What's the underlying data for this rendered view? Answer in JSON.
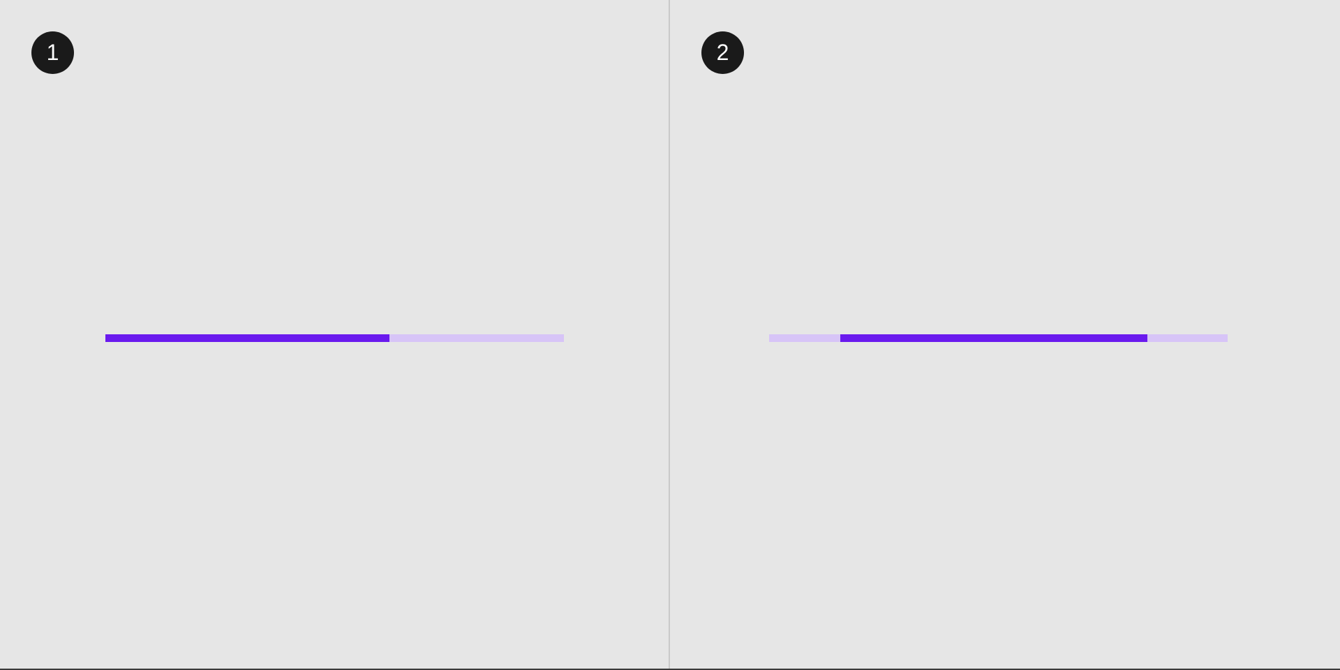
{
  "panels": [
    {
      "badge": "1",
      "progress_type": "determinate",
      "progress_value": 0.62
    },
    {
      "badge": "2",
      "progress_type": "indeterminate",
      "indicator_start": 0.155,
      "indicator_end": 0.825
    }
  ],
  "colors": {
    "background": "#e6e6e6",
    "badge_background": "#1a1a1a",
    "badge_text": "#ffffff",
    "track": "#d7c4f7",
    "indicator": "#6a1aee",
    "divider": "#c9c9c9"
  }
}
